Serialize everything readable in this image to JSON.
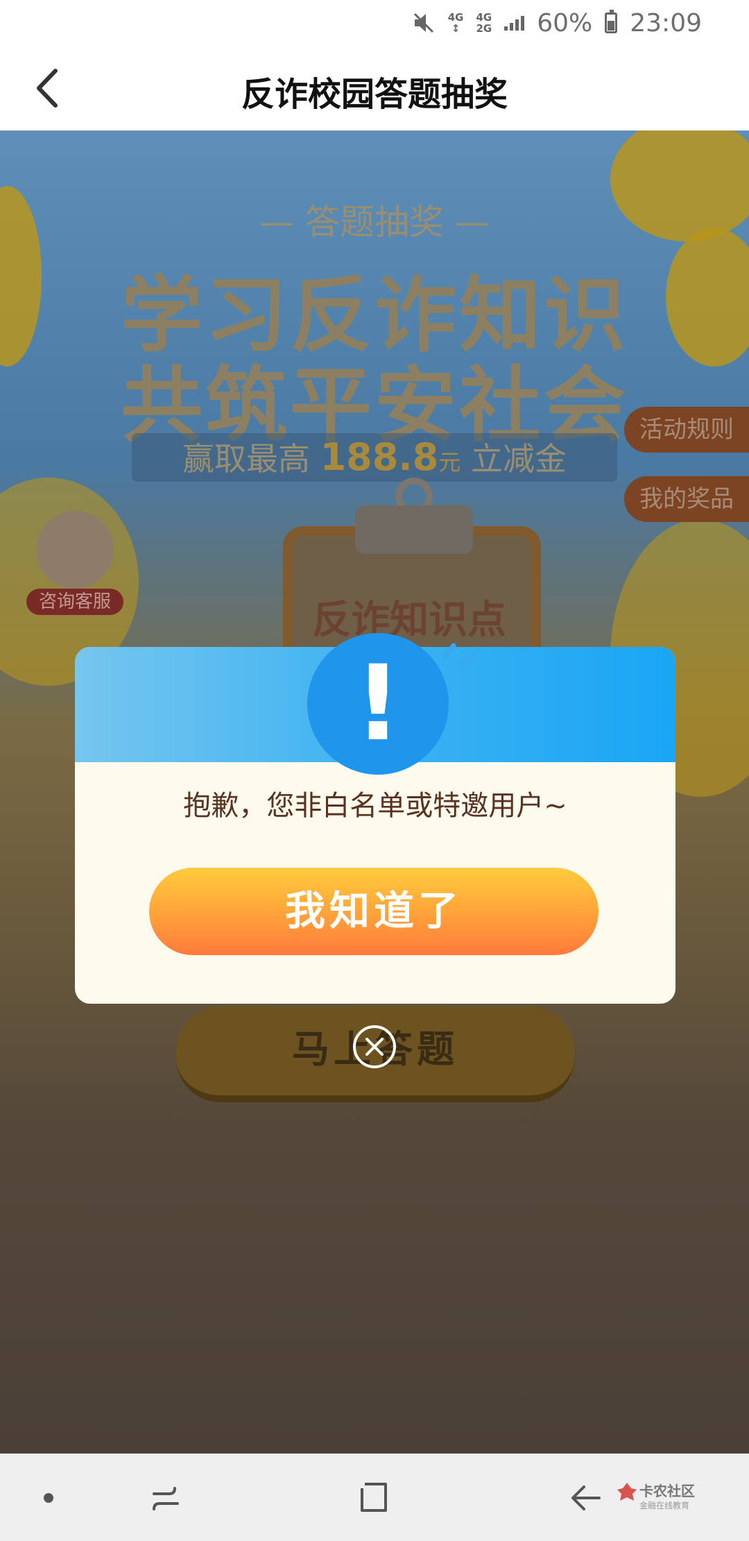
{
  "status_bar": {
    "net_top": "4G",
    "net_bottom": "4G",
    "net_bottom2": "2G",
    "battery": "60%",
    "time": "23:09"
  },
  "header": {
    "title": "反诈校园答题抽奖",
    "back_icon": "chevron-left-icon"
  },
  "banner": {
    "subtitle": "— 答题抽奖 —",
    "headline_line1": "学习反诈知识",
    "headline_line2": "共筑平安社会",
    "prize_prefix": "赢取最高",
    "prize_amount": "188.8",
    "prize_unit": "元",
    "prize_suffix": "立减金"
  },
  "side_buttons": {
    "rules": "活动规则",
    "prizes": "我的奖品"
  },
  "customer_service": {
    "label": "咨询客服"
  },
  "clipboard": {
    "text": "反诈知识点"
  },
  "start_button": {
    "label": "马上答题"
  },
  "modal": {
    "icon": "!",
    "message": "抱歉，您非白名单或特邀用户~",
    "ok_label": "我知道了",
    "close_icon": "close-circle-icon"
  },
  "watermark": {
    "title": "卡农社区",
    "subtitle": "金融在线教育"
  },
  "colors": {
    "modal_bg": "#fdfaee",
    "modal_header_blue": "#1aa6f4",
    "button_orange_top": "#ffcb3c",
    "button_orange_bottom": "#ff7a3c",
    "message_text": "#5a3220"
  }
}
